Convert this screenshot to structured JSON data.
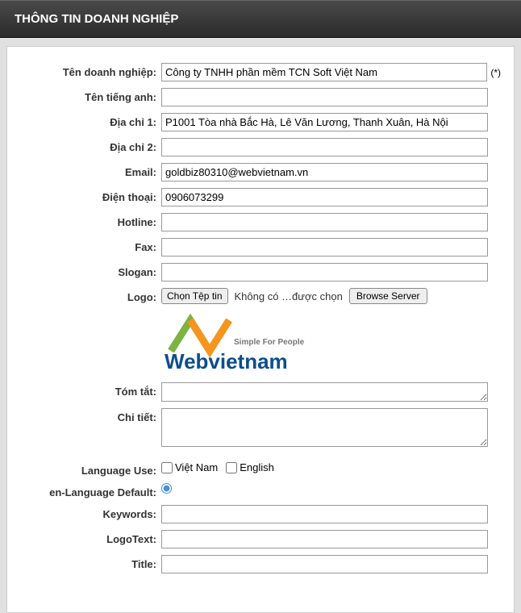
{
  "header": {
    "title": "THÔNG TIN DOANH NGHIỆP"
  },
  "labels": {
    "company": "Tên doanh nghiệp:",
    "enName": "Tên tiếng anh:",
    "addr1": "Địa chỉ 1:",
    "addr2": "Địa chỉ 2:",
    "email": "Email:",
    "phone": "Điện thoại:",
    "hotline": "Hotline:",
    "fax": "Fax:",
    "slogan": "Slogan:",
    "logo": "Logo:",
    "summary": "Tóm tắt:",
    "detail": "Chi tiết:",
    "langUse": "Language Use:",
    "langDefault": "en-Language Default:",
    "keywords": "Keywords:",
    "logoText": "LogoText:",
    "title": "Title:"
  },
  "values": {
    "company": "Công ty TNHH phần mềm TCN Soft Việt Nam",
    "enName": "",
    "addr1": "P1001 Tòa nhà Bắc Hà, Lê Văn Lương, Thanh Xuân, Hà Nội",
    "addr2": "",
    "email": "goldbiz80310@webvietnam.vn",
    "phone": "0906073299",
    "hotline": "",
    "fax": "",
    "slogan": "",
    "summary": "",
    "detail": "",
    "keywords": "",
    "logoText": "",
    "title": ""
  },
  "logo": {
    "chooseFile": "Chọn Tệp tin",
    "noFile": "Không có …được chọn",
    "browseServer": "Browse Server",
    "tagline": "Simple For People",
    "brand": "Webvietnam"
  },
  "lang": {
    "opt1": "Việt Nam",
    "opt2": "English"
  },
  "required": "(*)"
}
